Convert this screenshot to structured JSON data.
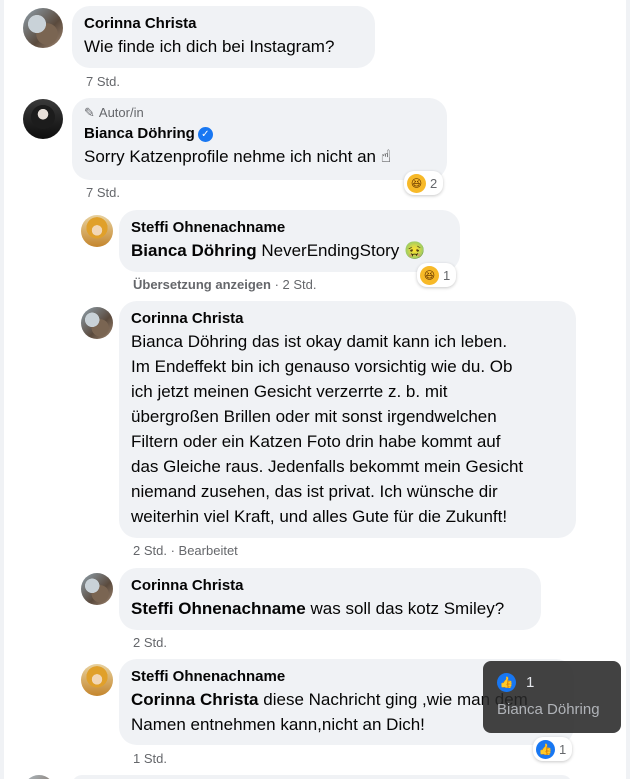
{
  "comments": [
    {
      "author": "Corinna Christa",
      "text": "Wie finde ich dich bei Instagram?",
      "time": "7 Std."
    },
    {
      "badge": "Autor/in",
      "author": "Bianca Döhring",
      "text": "Sorry Katzenprofile nehme ich nicht an ☝",
      "reaction_count": "2",
      "time": "7 Std."
    }
  ],
  "replies": [
    {
      "author": "Steffi Ohnenachname",
      "mention": "Bianca Döhring",
      "text": " NeverEndingStory 🤢",
      "reaction_count": "1",
      "translate": "Übersetzung anzeigen",
      "time": "2 Std."
    },
    {
      "author": "Corinna Christa",
      "mention": "Bianca Döhring",
      "lines": [
        " das ist okay damit kann ich leben.",
        "Im Endeffekt bin ich genauso vorsichtig wie du. Ob",
        "ich jetzt meinen Gesicht verzerrte z. b. mit",
        "übergroßen Brillen oder mit sonst irgendwelchen",
        "Filtern oder ein Katzen Foto drin habe kommt auf",
        "das Gleiche raus. Jedenfalls bekommt mein Gesicht",
        "niemand zusehen, das ist privat. Ich wünsche dir",
        "weiterhin viel Kraft, und alles Gute für die Zukunft!"
      ],
      "time": "2 Std.",
      "edited": "Bearbeitet"
    },
    {
      "author": "Corinna Christa",
      "mention": "Steffi Ohnenachname",
      "text": " was soll das kotz Smiley?",
      "time": "2 Std."
    },
    {
      "author": "Steffi Ohnenachname",
      "mention": "Corinna Christa",
      "line1": " diese Nachricht ging ,wie man dem",
      "line2": "Namen entnehmen kann,nicht an Dich!",
      "reaction_count": "1",
      "time": "1 Std."
    }
  ],
  "tooltip": {
    "count": "1",
    "name": "Bianca Döhring"
  },
  "separator": " · "
}
